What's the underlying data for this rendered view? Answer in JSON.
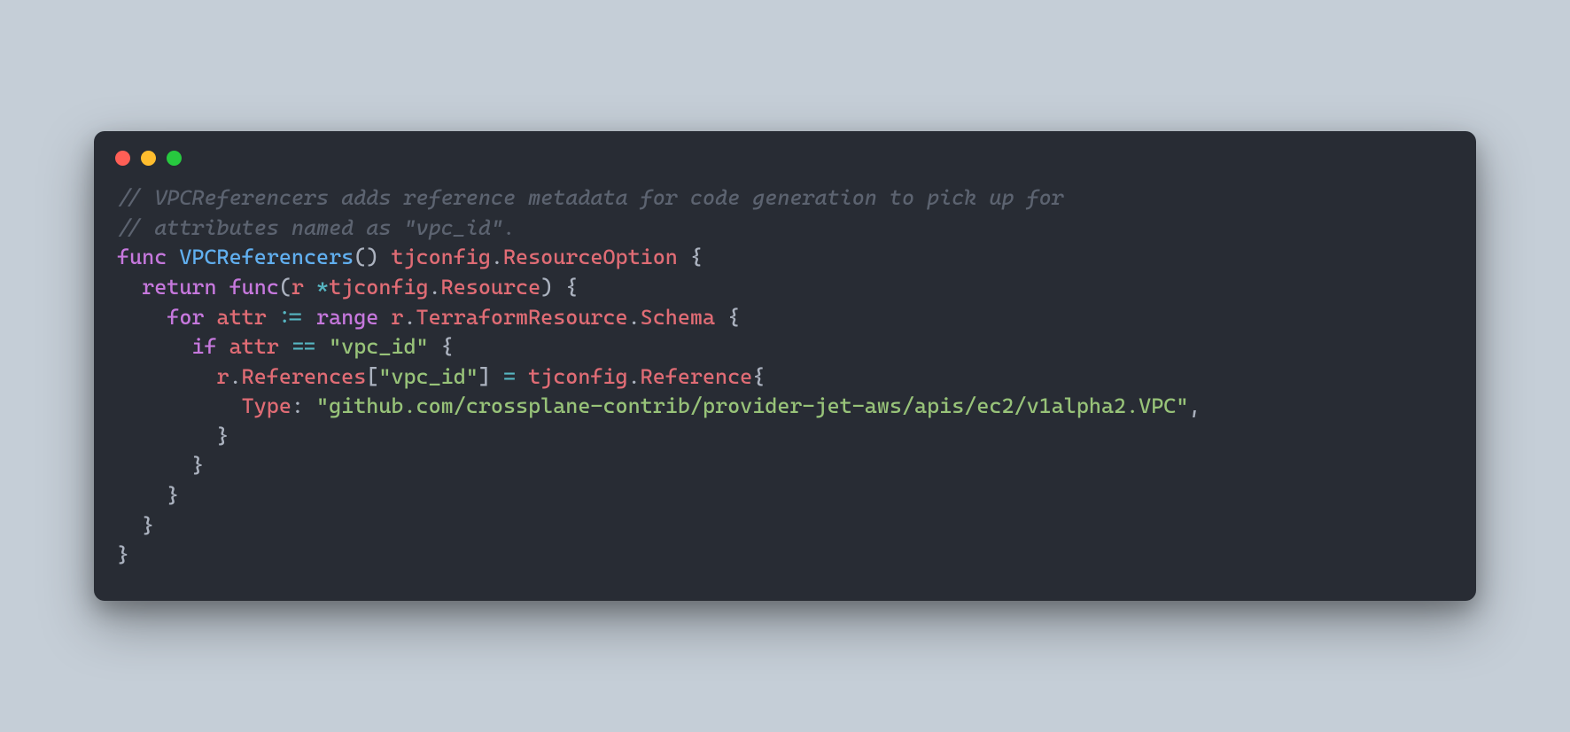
{
  "window": {
    "dots": [
      "red",
      "yellow",
      "green"
    ]
  },
  "code": {
    "c1": "// VPCReferencers adds reference metadata for code generation to pick up for",
    "c2": "// attributes named as \"vpc_id\".",
    "kw_func": "func",
    "fn_name": "VPCReferencers",
    "paren_open": "(",
    "paren_close": ")",
    "space": " ",
    "ret_pkg": "tjconfig",
    "dot": ".",
    "ret_type": "ResourceOption",
    "brace_open": " {",
    "indent1": "  ",
    "kw_return": "return",
    "kw_func2": "func",
    "param_r": "r",
    "star": "*",
    "param_pkg": "tjconfig",
    "param_type": "Resource",
    "indent2": "    ",
    "kw_for": "for",
    "ident_attr": "attr",
    "op_assign": ":=",
    "kw_range": "range",
    "ident_r": "r",
    "prop_tf": "TerraformResource",
    "prop_schema": "Schema",
    "indent3": "      ",
    "kw_if": "if",
    "op_eq": "==",
    "str_vpcid": "\"vpc_id\"",
    "indent4": "        ",
    "prop_refs": "References",
    "bracket_open": "[",
    "bracket_close": "]",
    "op_set": "=",
    "type_ref": "Reference",
    "brace_open2": "{",
    "indent5": "          ",
    "prop_type": "Type",
    "colon": ":",
    "str_path": "\"github.com/crossplane-contrib/provider-jet-aws/apis/ec2/v1alpha2.VPC\"",
    "comma": ",",
    "brace_close": "}",
    "indent_close4": "        }",
    "indent_close3": "      }",
    "indent_close2": "    }",
    "indent_close1": "  }",
    "indent_close0": "}"
  }
}
